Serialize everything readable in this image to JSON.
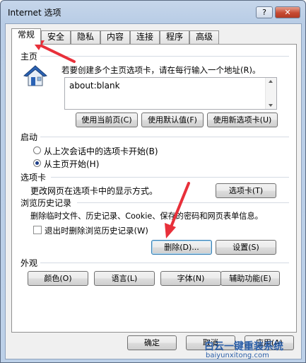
{
  "window": {
    "title": "Internet 选项",
    "help": "?",
    "close": "✕"
  },
  "tabs": [
    "常规",
    "安全",
    "隐私",
    "内容",
    "连接",
    "程序",
    "高级"
  ],
  "home": {
    "heading": "主页",
    "desc": "若要创建多个主页选项卡，请在每行输入一个地址(R)。",
    "url_value": "about:blank",
    "btn_current": "使用当前页(C)",
    "btn_default": "使用默认值(F)",
    "btn_newtab": "使用新选项卡(U)"
  },
  "startup": {
    "heading": "启动",
    "opt_last": "从上次会话中的选项卡开始(B)",
    "opt_home": "从主页开始(H)"
  },
  "tabsect": {
    "heading": "选项卡",
    "desc": "更改网页在选项卡中的显示方式。",
    "btn": "选项卡(T)"
  },
  "history": {
    "heading": "浏览历史记录",
    "desc": "删除临时文件、历史记录、Cookie、保存的密码和网页表单信息。",
    "chk_label": "退出时删除浏览历史记录(W)",
    "btn_delete": "删除(D)...",
    "btn_settings": "设置(S)"
  },
  "appearance": {
    "heading": "外观",
    "btn_colors": "颜色(O)",
    "btn_lang": "语言(L)",
    "btn_fonts": "字体(N)",
    "btn_access": "辅助功能(E)"
  },
  "footer": {
    "ok": "确定",
    "cancel": "取消",
    "apply": "应用(A)"
  },
  "watermark": {
    "line1": "白云一键重装系统",
    "line2": "baiyunxitong.com"
  },
  "colors": {
    "annotation_arrow": "#e8303a"
  }
}
